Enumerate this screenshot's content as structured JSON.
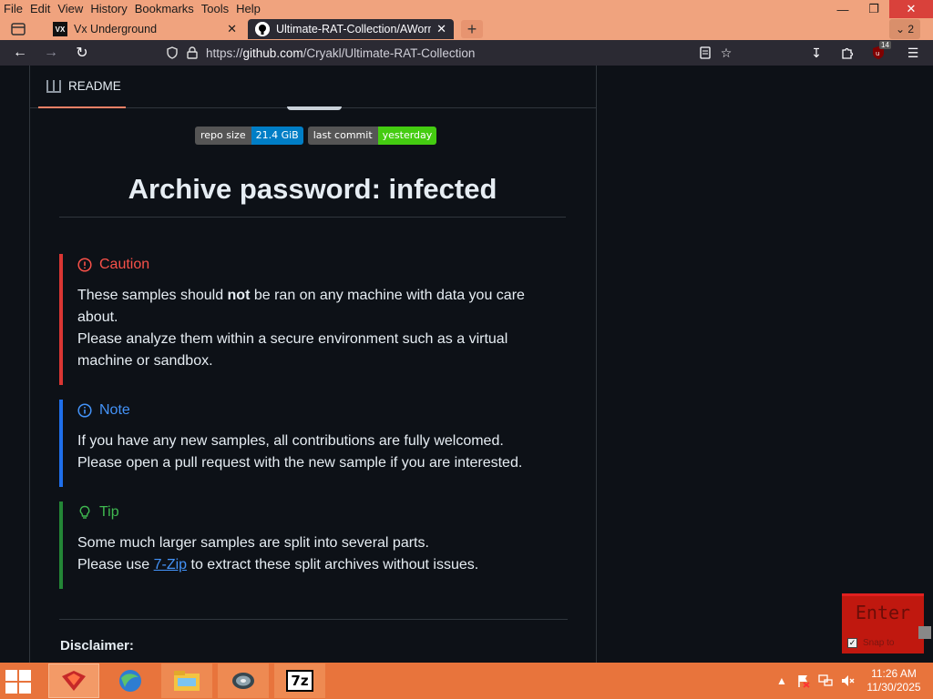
{
  "menubar": {
    "items": [
      "File",
      "Edit",
      "View",
      "History",
      "Bookmarks",
      "Tools",
      "Help"
    ]
  },
  "tabs": [
    {
      "title": "Vx Underground",
      "favicon": "VX",
      "active": false
    },
    {
      "title": "Ultimate-RAT-Collection/AWorm",
      "favicon": "github-icon",
      "active": true
    }
  ],
  "tabs_overflow_count": "2",
  "address": {
    "prefix": "https://",
    "domain": "github.com",
    "path": "/Cryakl/Ultimate-RAT-Collection"
  },
  "extension_badge": "14",
  "readme": {
    "tab_label": "README",
    "badges": [
      {
        "label": "repo size",
        "value": "21.4 GiB",
        "color": "#007ec6"
      },
      {
        "label": "last commit",
        "value": "yesterday",
        "color": "#4c1"
      }
    ],
    "title": "Archive password: infected",
    "caution": {
      "heading": "Caution",
      "line1_pre": "These samples should ",
      "line1_bold": "not",
      "line1_post": " be ran on any machine with data you care about.",
      "line2": "Please analyze them within a secure environment such as a virtual machine or sandbox."
    },
    "note": {
      "heading": "Note",
      "line1": "If you have any new samples, all contributions are fully welcomed.",
      "line2": "Please open a pull request with the new sample if you are interested."
    },
    "tip": {
      "heading": "Tip",
      "line1": "Some much larger samples are split into several parts.",
      "line2_pre": "Please use ",
      "line2_link": "7-Zip",
      "line2_post": " to extract these split archives without issues."
    },
    "disclaimer": "Disclaimer:"
  },
  "overlay": {
    "enter_label": "Enter",
    "snap_label": "Snap to"
  },
  "colors": {
    "caution": "#da3633",
    "note": "#1f6feb",
    "tip": "#238636",
    "firefox_frame": "#f0a37e",
    "taskbar": "#e8743c"
  },
  "taskbar": {
    "apps": [
      "red-dragon-app-icon",
      "browser-globe-icon",
      "file-explorer-icon",
      "disk-utility-icon",
      "7zip-icon"
    ],
    "app_7zip_label": "7z",
    "time": "11:26 AM",
    "date": "11/30/2025"
  }
}
